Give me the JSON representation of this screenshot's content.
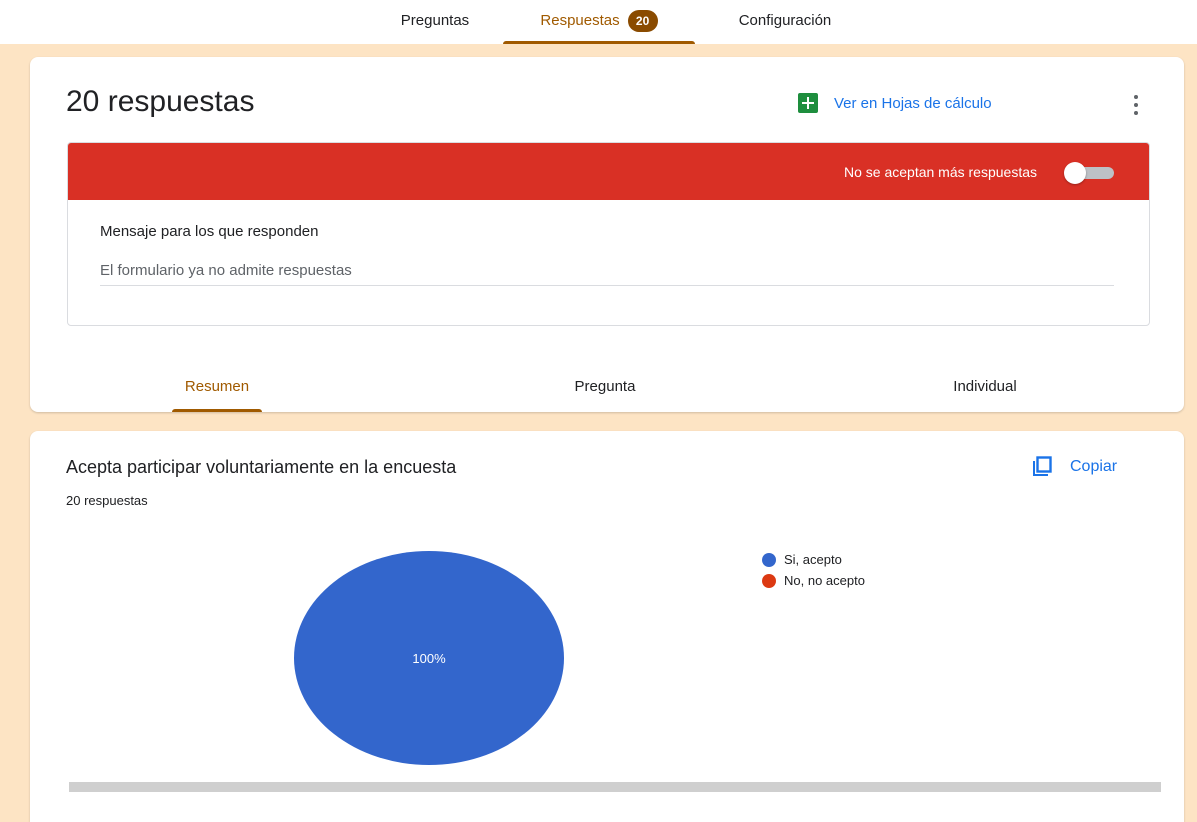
{
  "nav": {
    "tabs": [
      {
        "label": "Preguntas"
      },
      {
        "label": "Respuestas",
        "badge": "20"
      },
      {
        "label": "Configuración"
      }
    ],
    "active": "Respuestas"
  },
  "summary": {
    "title": "20 respuestas",
    "sheets_link": "Ver en Hojas de cálculo",
    "accepting_label": "No se aceptan más respuestas",
    "accepting_on": false,
    "message_label": "Mensaje para los que responden",
    "message_value": "El formulario ya no admite respuestas",
    "subtabs": [
      "Resumen",
      "Pregunta",
      "Individual"
    ],
    "active_subtab": "Resumen"
  },
  "question": {
    "title": "Acepta participar voluntariamente en la encuesta",
    "count": "20 respuestas",
    "copy_label": "Copiar"
  },
  "colors": {
    "accent": "#a05a00",
    "banner_red": "#d93025",
    "link_blue": "#1a73e8",
    "sheets_green": "#1e8e3e",
    "background": "#fde4c4"
  },
  "chart_data": {
    "type": "pie",
    "categories": [
      "Si, acepto",
      "No, no acepto"
    ],
    "values": [
      100,
      0
    ],
    "colors": [
      "#3366cc",
      "#dc3912"
    ],
    "slice_labels": [
      "100%"
    ],
    "legend_position": "right"
  }
}
